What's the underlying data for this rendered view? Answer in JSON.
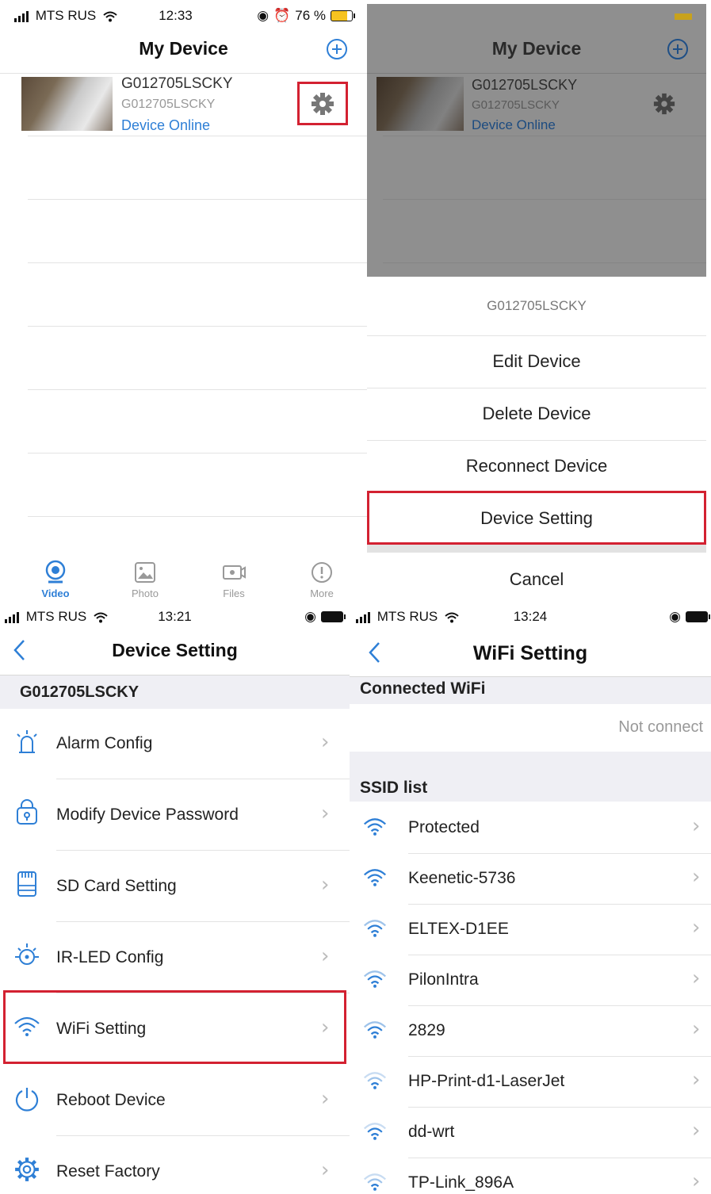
{
  "screen1": {
    "status": {
      "carrier": "MTS RUS",
      "time": "12:33",
      "battery": "76 %"
    },
    "title": "My Device",
    "device": {
      "name": "G012705LSCKY",
      "id": "G012705LSCKY",
      "status": "Device Online"
    },
    "tabs": [
      {
        "label": "Video",
        "icon": "camera-icon"
      },
      {
        "label": "Photo",
        "icon": "photo-icon"
      },
      {
        "label": "Files",
        "icon": "files-icon"
      },
      {
        "label": "More",
        "icon": "info-icon"
      }
    ]
  },
  "screen2": {
    "title": "My Device",
    "device": {
      "name": "G012705LSCKY",
      "id": "G012705LSCKY",
      "status": "Device Online"
    },
    "sheet": {
      "header": "G012705LSCKY",
      "items": [
        "Edit Device",
        "Delete Device",
        "Reconnect Device",
        "Device Setting"
      ],
      "cancel": "Cancel"
    }
  },
  "screen3": {
    "status": {
      "carrier": "MTS RUS",
      "time": "13:21"
    },
    "title": "Device Setting",
    "section": "G012705LSCKY",
    "items": [
      {
        "label": "Alarm Config",
        "icon": "alarm-icon"
      },
      {
        "label": "Modify Device Password",
        "icon": "lock-icon"
      },
      {
        "label": "SD Card Setting",
        "icon": "sdcard-icon"
      },
      {
        "label": "IR-LED Config",
        "icon": "led-icon"
      },
      {
        "label": "WiFi Setting",
        "icon": "wifi-icon"
      },
      {
        "label": "Reboot Device",
        "icon": "power-icon"
      },
      {
        "label": "Reset Factory",
        "icon": "gear-icon"
      }
    ]
  },
  "screen4": {
    "status": {
      "carrier": "MTS RUS",
      "time": "13:24"
    },
    "title": "WiFi Setting",
    "connected_header": "Connected WiFi",
    "connected_value": "Not connect",
    "ssid_header": "SSID list",
    "networks": [
      "Protected",
      "Keenetic-5736",
      "ELTEX-D1EE",
      "PilonIntra",
      "2829",
      "HP-Print-d1-LaserJet",
      "dd-wrt",
      "TP-Link_896A"
    ]
  },
  "colors": {
    "accent": "#2e7fd6",
    "highlight": "#d32131",
    "overlay": "#8f8f8f"
  }
}
